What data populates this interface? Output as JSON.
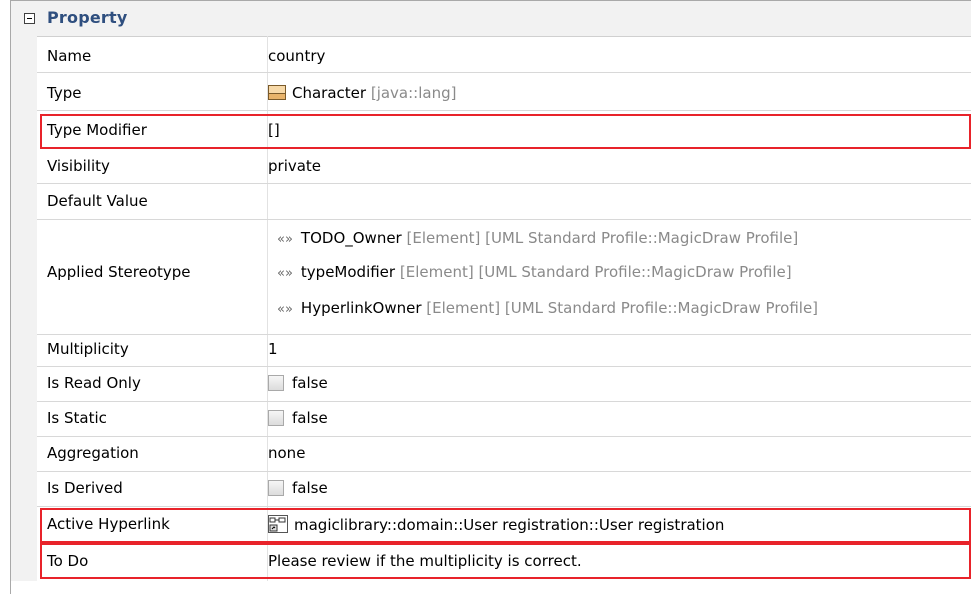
{
  "panel": {
    "section_title": "Property",
    "rows": [
      {
        "name": "Name",
        "value": "country"
      },
      {
        "name": "Type",
        "value": "Character",
        "suffix": "[java::lang]"
      },
      {
        "name": "Type Modifier",
        "value": "[]"
      },
      {
        "name": "Visibility",
        "value": "private"
      },
      {
        "name": "Default Value",
        "value": ""
      },
      {
        "name": "Applied Stereotype",
        "stereotypes": [
          {
            "name": "TODO_Owner",
            "suffix": "[Element] [UML Standard Profile::MagicDraw Profile]"
          },
          {
            "name": "typeModifier",
            "suffix": "[Element] [UML Standard Profile::MagicDraw Profile]"
          },
          {
            "name": "HyperlinkOwner",
            "suffix": "[Element] [UML Standard Profile::MagicDraw Profile]"
          }
        ],
        "stereo_glyph": "«»"
      },
      {
        "name": "Multiplicity",
        "value": "1"
      },
      {
        "name": "Is Read Only",
        "value": "false"
      },
      {
        "name": "Is Static",
        "value": "false"
      },
      {
        "name": "Aggregation",
        "value": "none"
      },
      {
        "name": "Is Derived",
        "value": "false"
      },
      {
        "name": "Active Hyperlink",
        "value": "magiclibrary::domain::User registration::User registration"
      },
      {
        "name": "To Do",
        "value": "Please review if the multiplicity is correct."
      }
    ]
  },
  "colors": {
    "highlight": "#e8232a",
    "section_title": "#2f4f7f"
  },
  "icons": {
    "type": "class-icon",
    "hyperlink": "diagram-link-icon",
    "toggle": "collapse-toggle-icon"
  }
}
